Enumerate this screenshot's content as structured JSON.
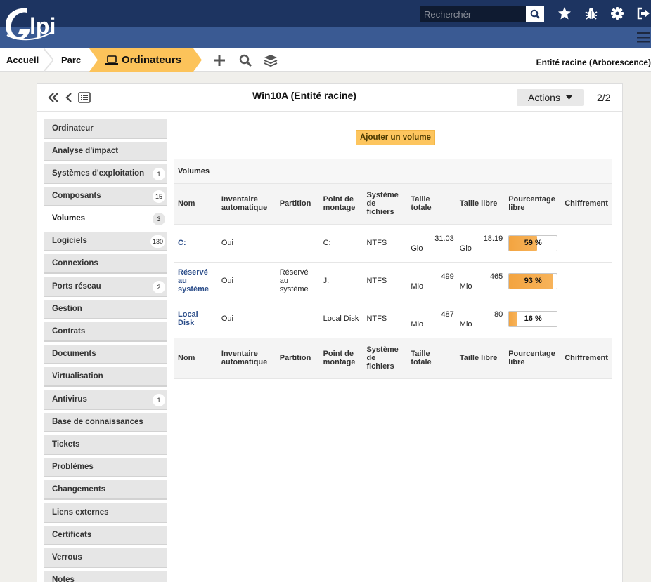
{
  "header": {
    "logo_text": "Glpi",
    "search_placeholder": "Recherchér",
    "icons": [
      "search-icon",
      "star-icon",
      "bug-icon",
      "gear-icon",
      "logout-icon",
      "menu-icon"
    ]
  },
  "breadcrumb": {
    "home": "Accueil",
    "parc": "Parc",
    "current": "Ordinateurs",
    "entity": "Entité racine (Arborescence)",
    "colors": {
      "active": "#fcc35a",
      "header": "#1d3461",
      "subheader": "#3a5a93"
    }
  },
  "item": {
    "title": "Win10A (Entité racine)",
    "actions_label": "Actions",
    "pager": "2/2"
  },
  "tabs": [
    {
      "label": "Ordinateur",
      "badge": null
    },
    {
      "label": "Analyse d'impact",
      "badge": null
    },
    {
      "label": "Systèmes d'exploitation",
      "badge": "1"
    },
    {
      "label": "Composants",
      "badge": "15"
    },
    {
      "label": "Volumes",
      "badge": "3",
      "active": true
    },
    {
      "label": "Logiciels",
      "badge": "130"
    },
    {
      "label": "Connexions",
      "badge": null
    },
    {
      "label": "Ports réseau",
      "badge": "2"
    },
    {
      "label": "Gestion",
      "badge": null
    },
    {
      "label": "Contrats",
      "badge": null
    },
    {
      "label": "Documents",
      "badge": null
    },
    {
      "label": "Virtualisation",
      "badge": null
    },
    {
      "label": "Antivirus",
      "badge": "1"
    },
    {
      "label": "Base de connaissances",
      "badge": null
    },
    {
      "label": "Tickets",
      "badge": null
    },
    {
      "label": "Problèmes",
      "badge": null
    },
    {
      "label": "Changements",
      "badge": null
    },
    {
      "label": "Liens externes",
      "badge": null
    },
    {
      "label": "Certificats",
      "badge": null
    },
    {
      "label": "Verrous",
      "badge": null
    },
    {
      "label": "Notes",
      "badge": null
    }
  ],
  "volumes": {
    "add_button": "Ajouter un volume",
    "caption": "Volumes",
    "columns": [
      "Nom",
      "Inventaire automatique",
      "Partition",
      "Point de montage",
      "Système de fichiers",
      "Taille totale",
      "Taille libre",
      "Pourcentage libre",
      "Chiffrement"
    ],
    "rows": [
      {
        "name": "C:",
        "auto": "Oui",
        "partition": "",
        "mount": "C:",
        "fs": "NTFS",
        "total": "31.03",
        "total_unit": "Gio",
        "free": "18.19",
        "free_unit": "Gio",
        "percent": 59,
        "percent_label": "59 %",
        "encryption": ""
      },
      {
        "name": "Réservé au système",
        "auto": "Oui",
        "partition": "Réservé au système",
        "mount": "J:",
        "fs": "NTFS",
        "total": "499",
        "total_unit": "Mio",
        "free": "465",
        "free_unit": "Mio",
        "percent": 93,
        "percent_label": "93 %",
        "encryption": ""
      },
      {
        "name": "Local Disk",
        "auto": "Oui",
        "partition": "",
        "mount": "Local Disk",
        "fs": "NTFS",
        "total": "487",
        "total_unit": "Mio",
        "free": "80",
        "free_unit": "Mio",
        "percent": 16,
        "percent_label": "16 %",
        "encryption": ""
      }
    ]
  }
}
